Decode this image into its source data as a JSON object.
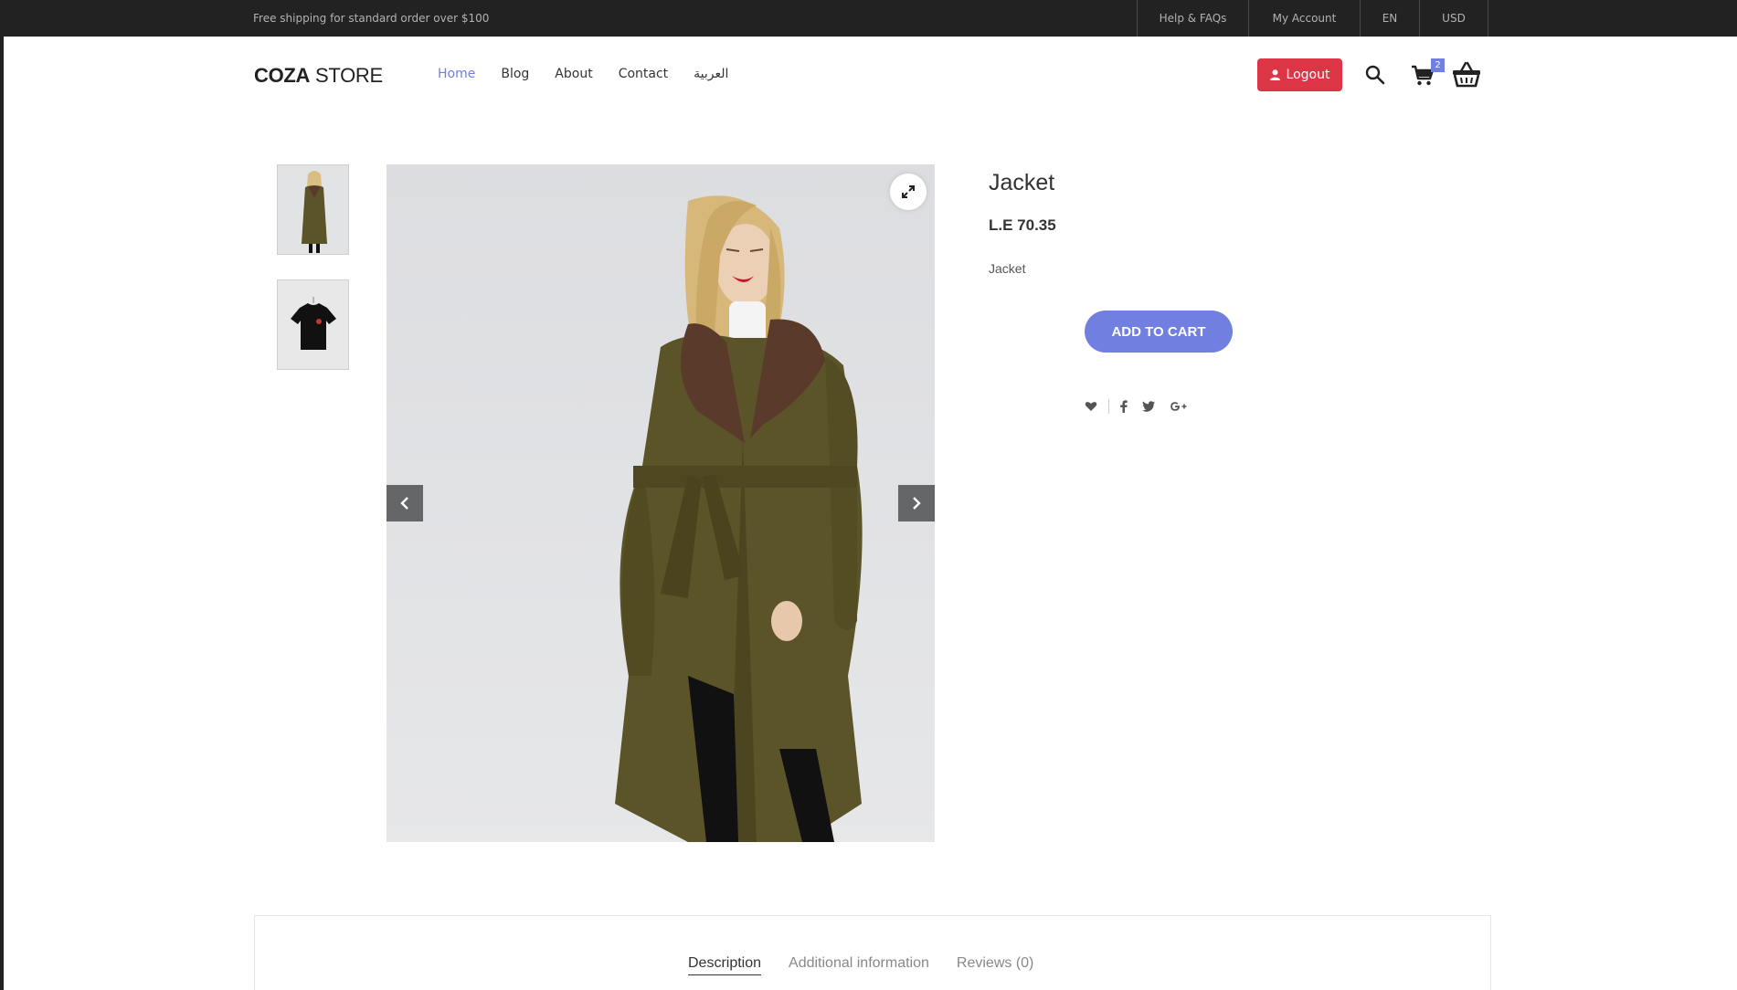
{
  "topbar": {
    "promo": "Free shipping for standard order over $100",
    "links": [
      "Help & FAQs",
      "My Account",
      "EN",
      "USD"
    ]
  },
  "header": {
    "logo_bold": "COZA",
    "logo_light": " STORE",
    "nav": [
      "Home",
      "Blog",
      "About",
      "Contact",
      "العربية"
    ],
    "logout_label": "Logout",
    "cart_count": "2"
  },
  "product": {
    "title": "Jacket",
    "price": "L.E 70.35",
    "description": "Jacket",
    "add_to_cart": "ADD TO CART"
  },
  "tabs": [
    "Description",
    "Additional information",
    "Reviews (0)"
  ],
  "colors": {
    "accent": "#717fe0",
    "logout": "#dc3545",
    "topbar": "#222222",
    "coat": "#5b5428",
    "fur": "#5a3a2a"
  }
}
